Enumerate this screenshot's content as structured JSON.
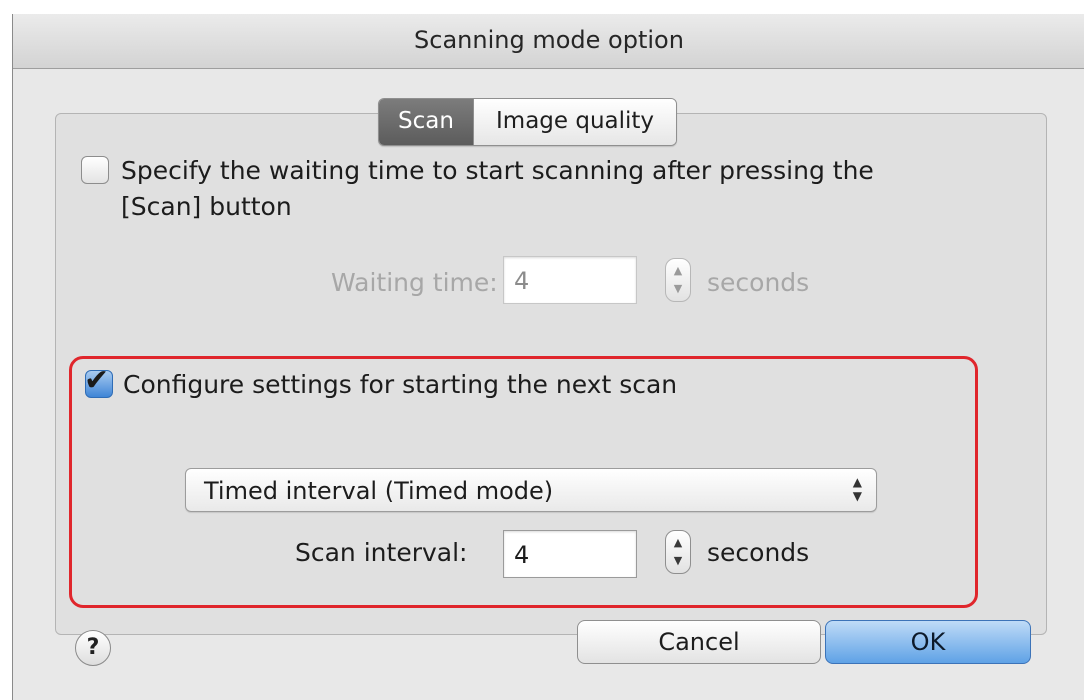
{
  "window": {
    "title": "Scanning mode option"
  },
  "tabs": [
    {
      "label": "Scan",
      "active": true
    },
    {
      "label": "Image quality",
      "active": false
    }
  ],
  "waiting": {
    "checkbox_label_line1": "Specify the waiting time to start scanning after pressing the",
    "checkbox_label_line2": "[Scan] button",
    "checked": false,
    "time_label": "Waiting time:",
    "time_value": "4",
    "unit": "seconds"
  },
  "next_scan": {
    "checkbox_label": "Configure settings for starting the next scan",
    "checked": true,
    "mode_selected": "Timed interval (Timed mode)",
    "interval_label": "Scan interval:",
    "interval_value": "4",
    "unit": "seconds"
  },
  "buttons": {
    "help": "?",
    "cancel": "Cancel",
    "ok": "OK"
  },
  "colors": {
    "highlight": "#e0262c",
    "ok_button": "#5fa2e6",
    "active_tab": "#6b6b6b"
  },
  "icons": {
    "checkmark": "✔",
    "stepper_up": "▲",
    "stepper_down": "▼"
  }
}
